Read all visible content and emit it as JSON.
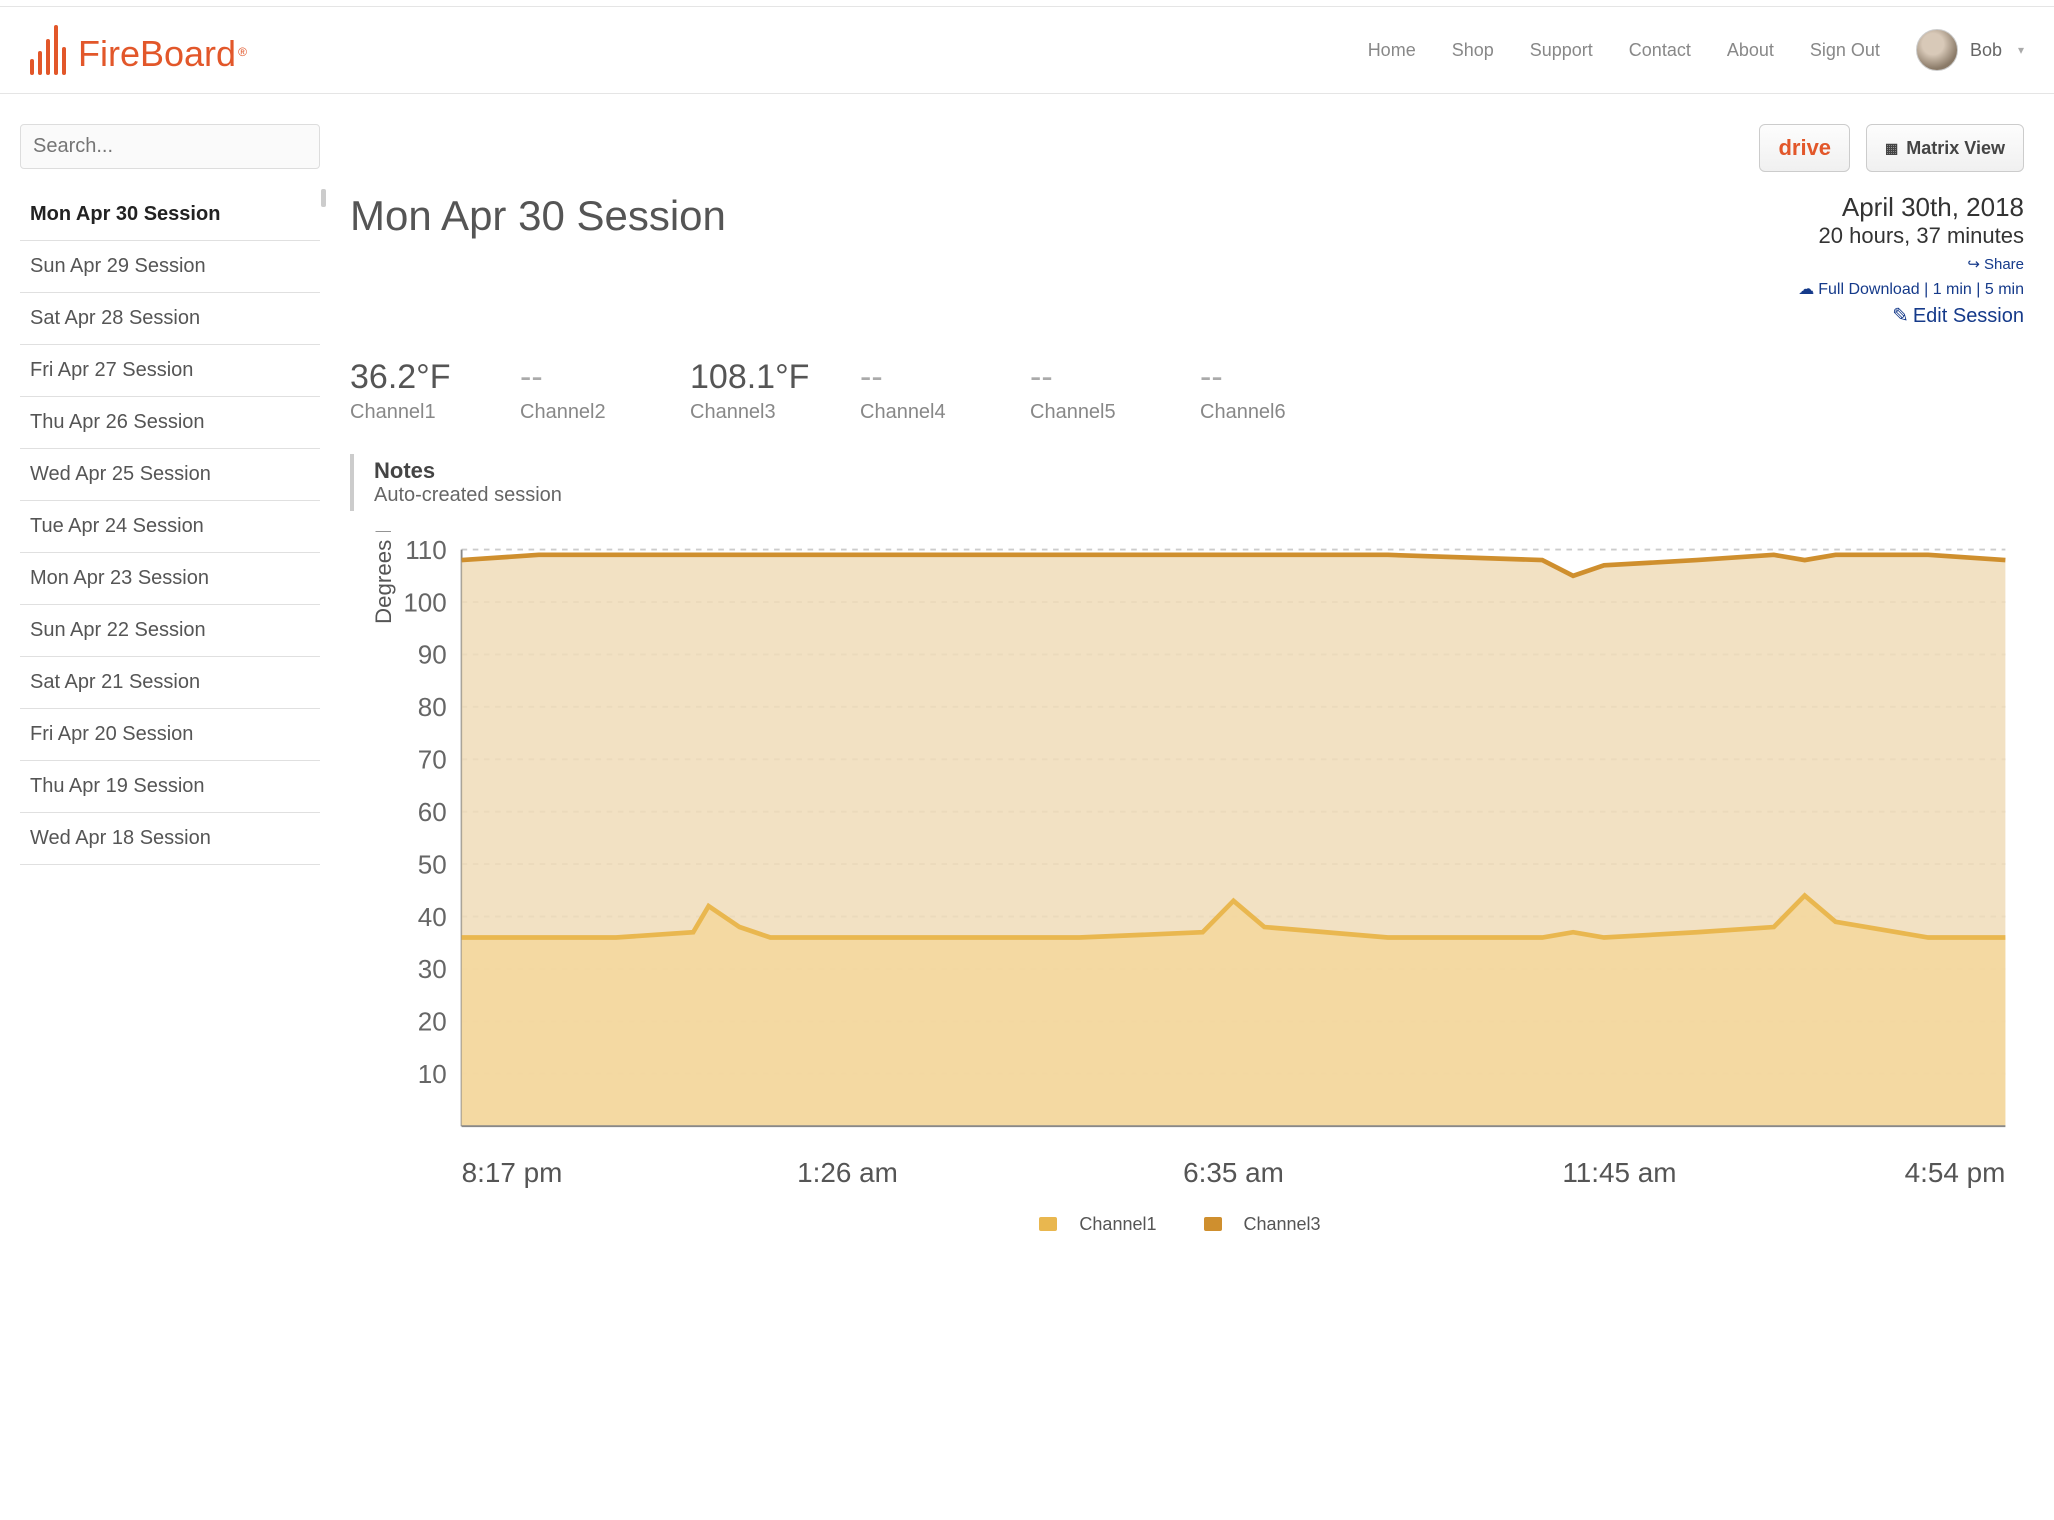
{
  "brand": "FireBoard",
  "nav": {
    "home": "Home",
    "shop": "Shop",
    "support": "Support",
    "contact": "Contact",
    "about": "About",
    "signout": "Sign Out"
  },
  "user": {
    "name": "Bob"
  },
  "buttons": {
    "drive": "drive",
    "matrix": "Matrix View"
  },
  "search": {
    "placeholder": "Search..."
  },
  "sessions": [
    "Mon Apr 30 Session",
    "Sun Apr 29 Session",
    "Sat Apr 28 Session",
    "Fri Apr 27 Session",
    "Thu Apr 26 Session",
    "Wed Apr 25 Session",
    "Tue Apr 24 Session",
    "Mon Apr 23 Session",
    "Sun Apr 22 Session",
    "Sat Apr 21 Session",
    "Fri Apr 20 Session",
    "Thu Apr 19 Session",
    "Wed Apr 18 Session"
  ],
  "active_session_index": 0,
  "session": {
    "title": "Mon Apr 30 Session",
    "date": "April 30th, 2018",
    "duration": "20 hours, 37 minutes",
    "share": "Share",
    "full_download": "Full Download",
    "one_min": "1 min",
    "five_min": "5 min",
    "edit": "Edit Session"
  },
  "channels": [
    {
      "value": "36.2°F",
      "label": "Channel1",
      "active": true
    },
    {
      "value": "--",
      "label": "Channel2",
      "active": false
    },
    {
      "value": "108.1°F",
      "label": "Channel3",
      "active": true
    },
    {
      "value": "--",
      "label": "Channel4",
      "active": false
    },
    {
      "value": "--",
      "label": "Channel5",
      "active": false
    },
    {
      "value": "--",
      "label": "Channel6",
      "active": false
    }
  ],
  "notes": {
    "title": "Notes",
    "body": "Auto-created session"
  },
  "legend": {
    "c1": "Channel1",
    "c3": "Channel3"
  },
  "chart_data": {
    "type": "line",
    "title": "",
    "xlabel": "",
    "ylabel": "Degrees F",
    "ylim": [
      0,
      110
    ],
    "y_ticks": [
      10,
      20,
      30,
      40,
      50,
      60,
      70,
      80,
      90,
      100,
      110
    ],
    "x_ticks": [
      "8:17 pm",
      "1:26 am",
      "6:35 am",
      "11:45 am",
      "4:54 pm"
    ],
    "x": [
      0,
      0.05,
      0.1,
      0.15,
      0.16,
      0.18,
      0.2,
      0.3,
      0.4,
      0.48,
      0.5,
      0.52,
      0.6,
      0.7,
      0.72,
      0.74,
      0.8,
      0.85,
      0.87,
      0.89,
      0.95,
      1.0
    ],
    "series": [
      {
        "name": "Channel1",
        "color": "#e9b74f",
        "fill": "#f4d79c",
        "values": [
          36,
          36,
          36,
          37,
          42,
          38,
          36,
          36,
          36,
          37,
          43,
          38,
          36,
          36,
          37,
          36,
          37,
          38,
          44,
          39,
          36,
          36
        ]
      },
      {
        "name": "Channel3",
        "color": "#cf8f2e",
        "fill": "#f0dcb8",
        "values": [
          108,
          109,
          109,
          109,
          109,
          109,
          109,
          109,
          109,
          109,
          109,
          109,
          109,
          108,
          105,
          107,
          108,
          109,
          108,
          109,
          109,
          108
        ]
      }
    ]
  }
}
